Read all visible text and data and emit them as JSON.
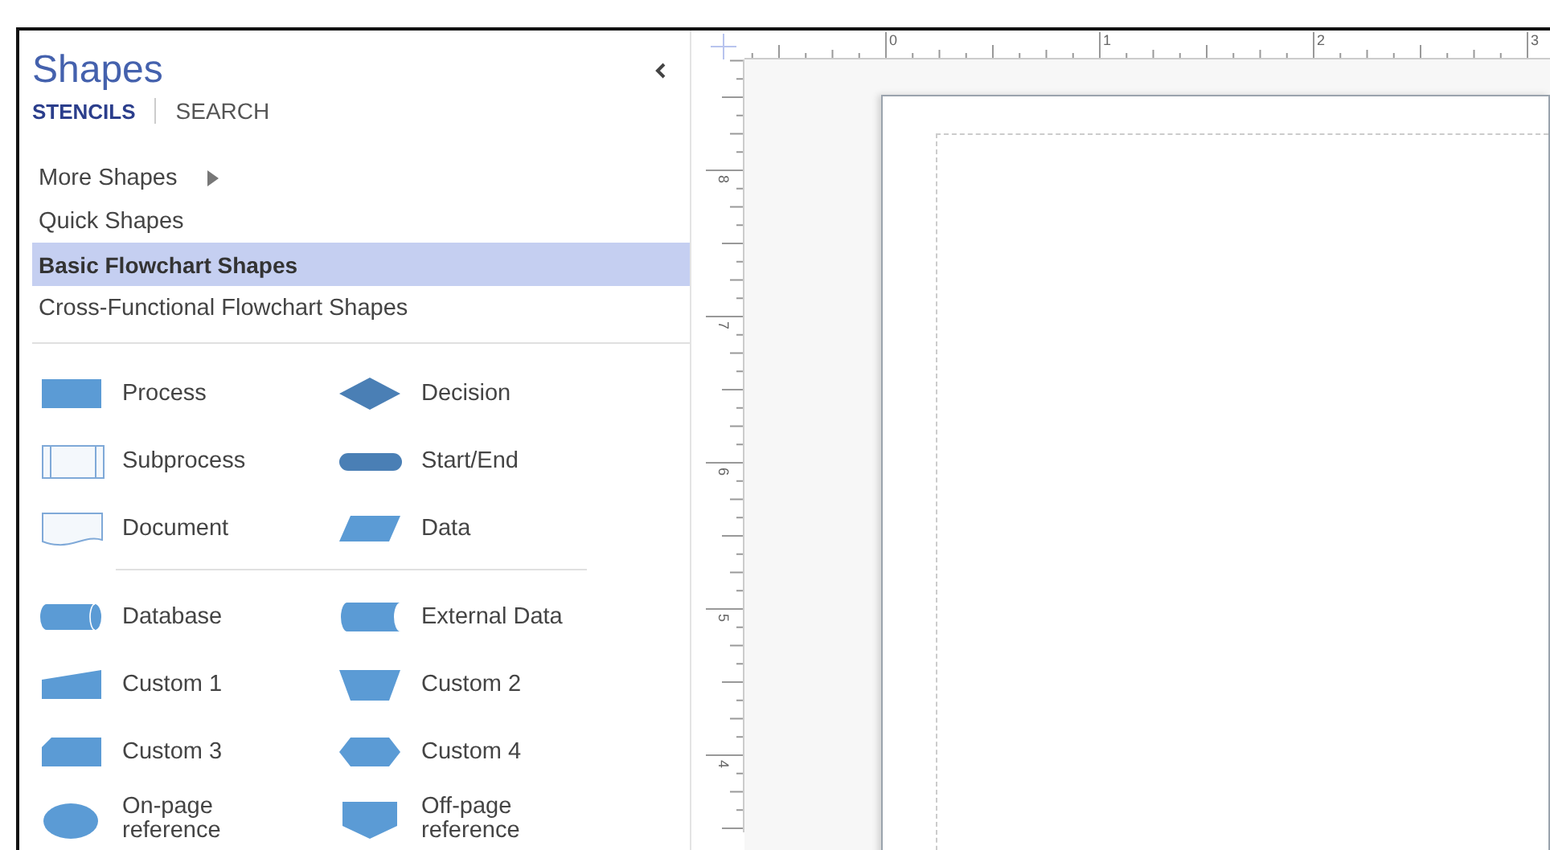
{
  "panel": {
    "title": "Shapes",
    "tabs": [
      {
        "label": "STENCILS",
        "selected": true
      },
      {
        "label": "SEARCH",
        "selected": false
      }
    ],
    "stencils": [
      {
        "label": "More Shapes",
        "submenu": true,
        "selected": false
      },
      {
        "label": "Quick Shapes",
        "submenu": false,
        "selected": false
      },
      {
        "label": "Basic Flowchart Shapes",
        "submenu": false,
        "selected": true
      },
      {
        "label": "Cross-Functional Flowchart Shapes",
        "submenu": false,
        "selected": false
      }
    ],
    "shape_groups": [
      [
        {
          "label": "Process",
          "kind": "process"
        },
        {
          "label": "Decision",
          "kind": "decision"
        },
        {
          "label": "Subprocess",
          "kind": "subprocess"
        },
        {
          "label": "Start/End",
          "kind": "startend"
        },
        {
          "label": "Document",
          "kind": "document"
        },
        {
          "label": "Data",
          "kind": "data"
        }
      ],
      [
        {
          "label": "Database",
          "kind": "database"
        },
        {
          "label": "External Data",
          "kind": "external"
        },
        {
          "label": "Custom 1",
          "kind": "custom1"
        },
        {
          "label": "Custom 2",
          "kind": "custom2"
        },
        {
          "label": "Custom 3",
          "kind": "custom3"
        },
        {
          "label": "Custom 4",
          "kind": "custom4"
        },
        {
          "label": "On-page\nreference",
          "kind": "onpage"
        },
        {
          "label": "Off-page\nreference",
          "kind": "offpage"
        }
      ]
    ]
  },
  "rulers": {
    "top_labels": [
      "0",
      "1",
      "2",
      "3"
    ],
    "left_labels": [
      "8",
      "7",
      "6",
      "5",
      "4"
    ]
  }
}
